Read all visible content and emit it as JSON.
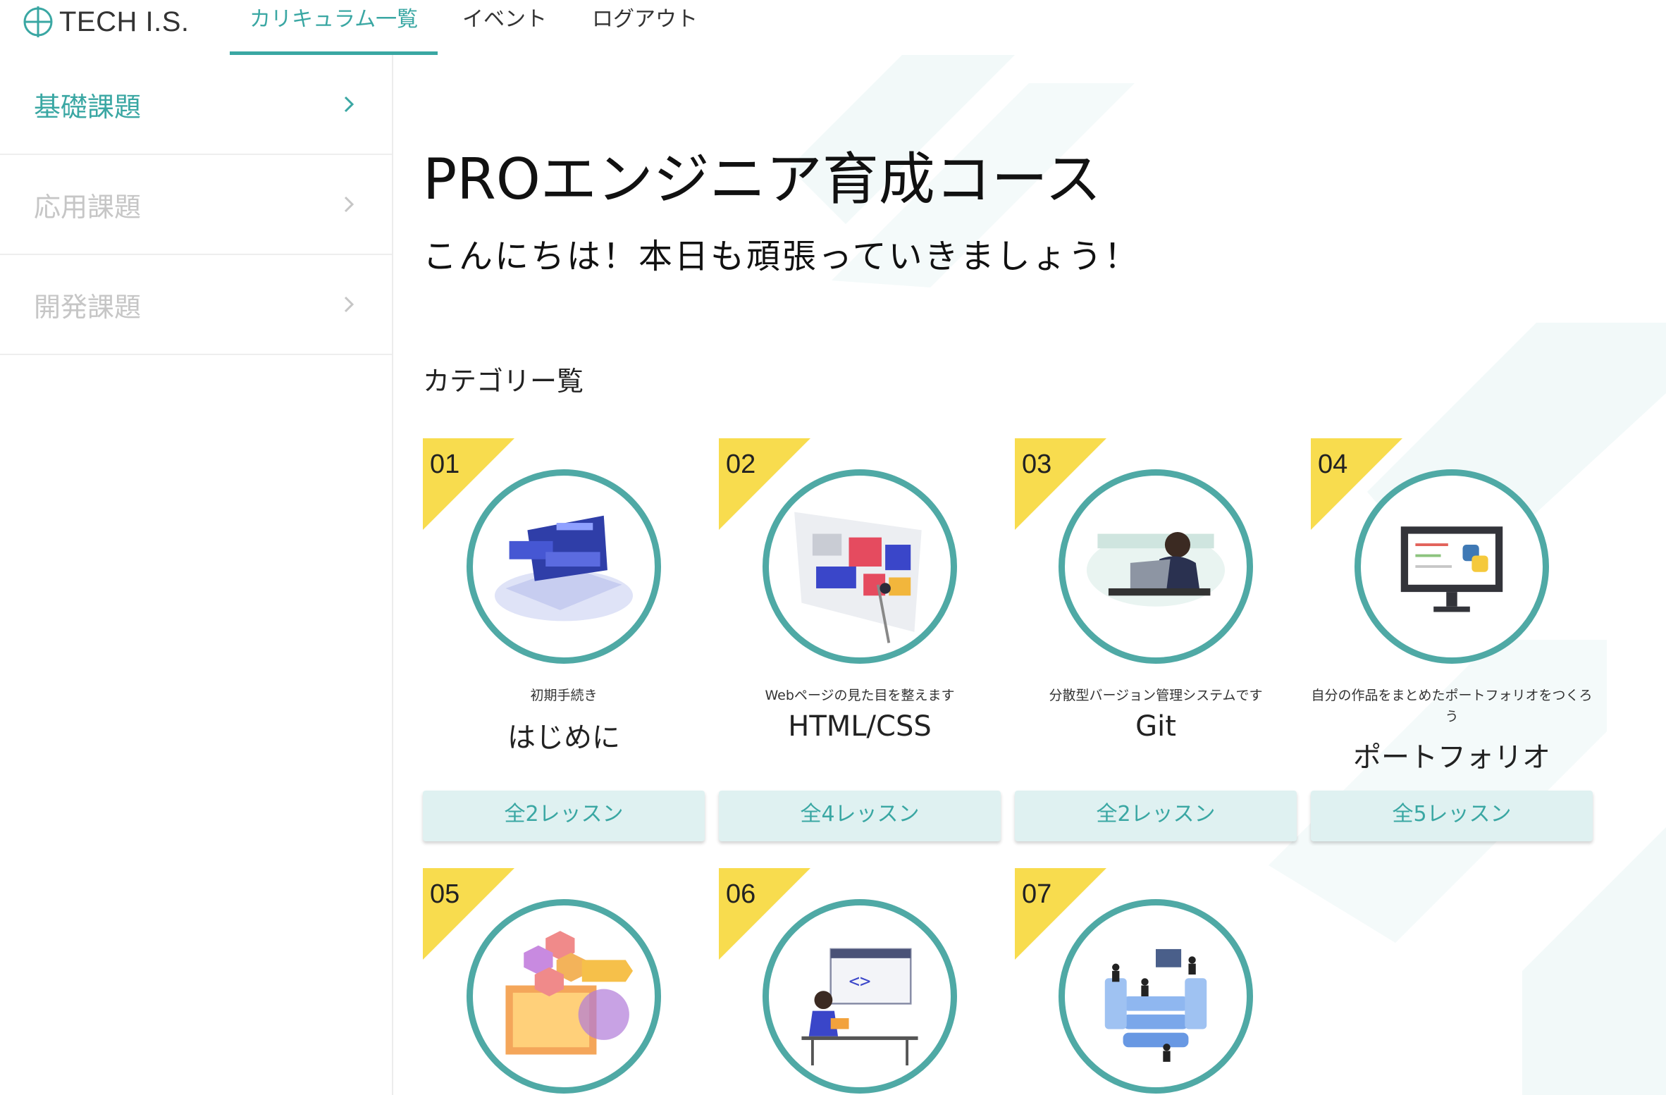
{
  "header": {
    "brand": "TECH I.S.",
    "tabs": [
      {
        "label": "カリキュラム一覧",
        "active": true
      },
      {
        "label": "イベント",
        "active": false
      },
      {
        "label": "ログアウト",
        "active": false
      }
    ]
  },
  "sidebar": {
    "items": [
      {
        "label": "基礎課題",
        "active": true
      },
      {
        "label": "応用課題",
        "active": false
      },
      {
        "label": "開発課題",
        "active": false
      }
    ]
  },
  "main": {
    "title": "PROエンジニア育成コース",
    "greeting": "こんにちは！本日も頑張っていきましょう！",
    "section_title": "カテゴリー覧",
    "cards": [
      {
        "num": "01",
        "desc": "初期手続き",
        "name": "はじめに",
        "lessons": "全2レッスン",
        "icon": "laptop-code-illustration"
      },
      {
        "num": "02",
        "desc": "Webページの見た目を整えます",
        "name": "HTML/CSS",
        "lessons": "全4レッスン",
        "icon": "web-layout-illustration"
      },
      {
        "num": "03",
        "desc": "分散型バージョン管理システムです",
        "name": "Git",
        "lessons": "全2レッスン",
        "icon": "person-laptop-illustration"
      },
      {
        "num": "04",
        "desc": "自分の作品をまとめたポートフォリオをつくろう",
        "name": "ポートフォリオ",
        "lessons": "全5レッスン",
        "icon": "python-monitor-illustration"
      },
      {
        "num": "05",
        "icon": "hexagon-dev-illustration"
      },
      {
        "num": "06",
        "icon": "desk-coding-illustration"
      },
      {
        "num": "07",
        "icon": "server-team-illustration"
      }
    ]
  },
  "colors": {
    "accent": "#3aa7a3",
    "ring": "#4fa9a5",
    "badge": "#f8dc4e",
    "button_bg": "#dff1f1"
  }
}
